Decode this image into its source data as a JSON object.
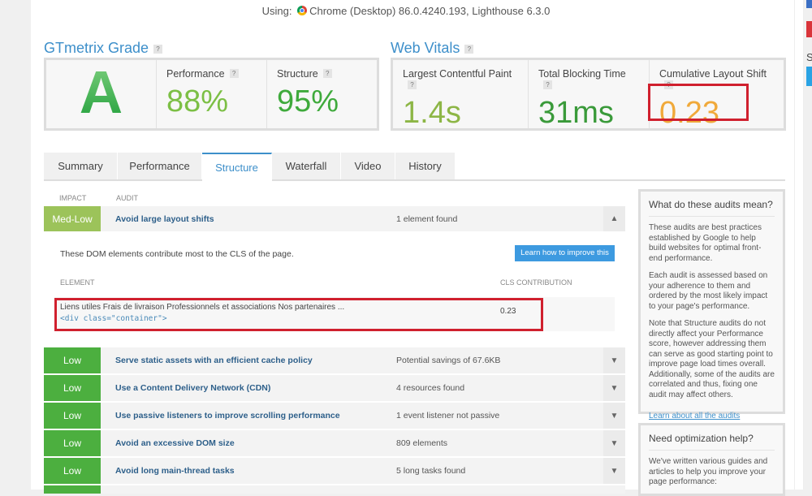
{
  "header": {
    "using_label": "Using:",
    "browser": "Chrome (Desktop) 86.0.4240.193, Lighthouse 6.3.0"
  },
  "grade": {
    "title": "GTmetrix Grade",
    "help": "?",
    "letter": "A",
    "performance_label": "Performance",
    "performance_value": "88%",
    "structure_label": "Structure",
    "structure_value": "95%"
  },
  "vitals": {
    "title": "Web Vitals",
    "help": "?",
    "lcp_label": "Largest Contentful Paint",
    "lcp_value": "1.4s",
    "tbt_label": "Total Blocking Time",
    "tbt_value": "31ms",
    "cls_label": "Cumulative Layout Shift",
    "cls_value": "0.23"
  },
  "tabs": [
    "Summary",
    "Performance",
    "Structure",
    "Waterfall",
    "Video",
    "History"
  ],
  "table": {
    "impact_header": "IMPACT",
    "audit_header": "AUDIT"
  },
  "expanded": {
    "impact": "Med-Low",
    "name": "Avoid large layout shifts",
    "result": "1 element found",
    "description": "These DOM elements contribute most to the CLS of the page.",
    "button": "Learn how to improve this",
    "element_header": "ELEMENT",
    "cls_header": "CLS CONTRIBUTION",
    "element_text": "Liens utiles Frais de livraison Professionnels et associations Nos partenaires ...",
    "element_code": "<div class=\"container\">",
    "element_cls": "0.23"
  },
  "audits": [
    {
      "impact": "Low",
      "name": "Serve static assets with an efficient cache policy",
      "result": "Potential savings of 67.6KB"
    },
    {
      "impact": "Low",
      "name": "Use a Content Delivery Network (CDN)",
      "result": "4 resources found"
    },
    {
      "impact": "Low",
      "name": "Use passive listeners to improve scrolling performance",
      "result": "1 event listener not passive"
    },
    {
      "impact": "Low",
      "name": "Avoid an excessive DOM size",
      "result": "809 elements"
    },
    {
      "impact": "Low",
      "name": "Avoid long main-thread tasks",
      "result": "5 long tasks found"
    }
  ],
  "sidebar": {
    "box1_title": "What do these audits mean?",
    "box1_p1": "These audits are best practices established by Google to help build websites for optimal front-end performance.",
    "box1_p2": "Each audit is assessed based on your adherence to them and ordered by the most likely impact to your page's performance.",
    "box1_p3": "Note that Structure audits do not directly affect your Performance score, however addressing them can serve as good starting point to improve page load times overall. Additionally, some of the audits are correlated and thus, fixing one audit may affect others.",
    "box1_link": "Learn about all the audits",
    "box2_title": "Need optimization help?",
    "box2_p1": "We've written various guides and articles to help you improve your page performance:"
  },
  "right_edge": {
    "letter": "S"
  },
  "colors": {
    "accent": "#3d8fca",
    "medlow": "#9cc35a",
    "low": "#4caf3f",
    "highlight": "#d0202e",
    "cls": "#f0a93a"
  }
}
